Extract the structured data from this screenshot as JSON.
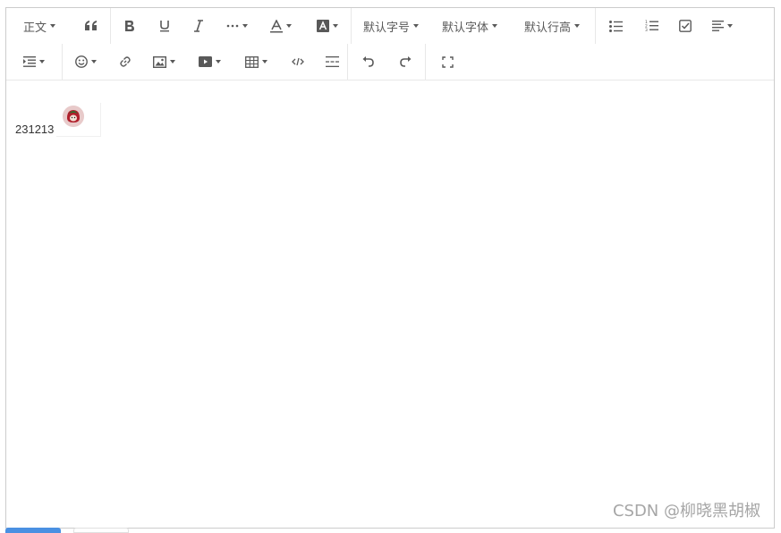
{
  "toolbar": {
    "row1": [
      {
        "name": "heading-select",
        "label": "正文",
        "dropdown": true
      },
      {
        "name": "blockquote-icon",
        "icon": "quote"
      },
      {
        "name": "bold-icon",
        "icon": "bold"
      },
      {
        "name": "underline-icon",
        "icon": "underline"
      },
      {
        "name": "italic-icon",
        "icon": "italic"
      },
      {
        "name": "more-style-icon",
        "icon": "more",
        "dropdown": true
      },
      {
        "name": "font-color-icon",
        "icon": "font-color",
        "dropdown": true
      },
      {
        "name": "bg-color-icon",
        "icon": "bg-color",
        "dropdown": true
      },
      {
        "name": "font-size-select",
        "label": "默认字号",
        "dropdown": true
      },
      {
        "name": "font-family-select",
        "label": "默认字体",
        "dropdown": true
      },
      {
        "name": "line-height-select",
        "label": "默认行高",
        "dropdown": true
      },
      {
        "name": "bulleted-list-icon",
        "icon": "ul"
      },
      {
        "name": "numbered-list-icon",
        "icon": "ol"
      },
      {
        "name": "todo-icon",
        "icon": "todo"
      },
      {
        "name": "justify-icon",
        "icon": "justify",
        "dropdown": true
      }
    ],
    "row2": [
      {
        "name": "indent-icon",
        "icon": "indent",
        "dropdown": true
      },
      {
        "name": "emoji-icon",
        "icon": "emoji",
        "dropdown": true
      },
      {
        "name": "link-icon",
        "icon": "link"
      },
      {
        "name": "image-icon",
        "icon": "image",
        "dropdown": true
      },
      {
        "name": "video-icon",
        "icon": "video",
        "dropdown": true
      },
      {
        "name": "table-icon",
        "icon": "table",
        "dropdown": true
      },
      {
        "name": "code-block-icon",
        "icon": "code"
      },
      {
        "name": "divider-icon",
        "icon": "divider"
      },
      {
        "name": "undo-icon",
        "icon": "undo"
      },
      {
        "name": "redo-icon",
        "icon": "redo"
      },
      {
        "name": "fullscreen-icon",
        "icon": "fullscreen"
      }
    ],
    "labels": {
      "heading": "正文",
      "font_size": "默认字号",
      "font_family": "默认字体",
      "line_height": "默认行高"
    }
  },
  "editor": {
    "paragraph_text": "231213",
    "inline_image": "avatar-image"
  },
  "watermark": "CSDN @柳晓黑胡椒",
  "colors": {
    "icon": "#595959",
    "border": "#cccccc",
    "divider": "#e8e8e8",
    "tab_active": "#4a90e2"
  }
}
